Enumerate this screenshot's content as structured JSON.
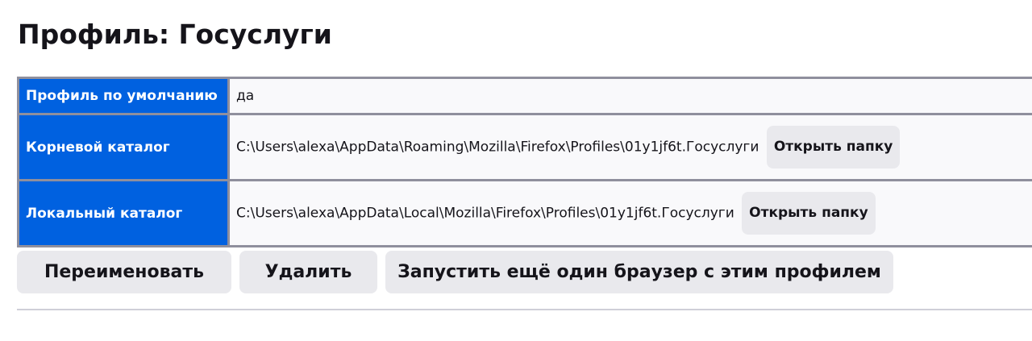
{
  "page": {
    "title": "Профиль: Госуслуги"
  },
  "profile_table": {
    "default": {
      "label": "Профиль по умолчанию",
      "value": "да"
    },
    "root_dir": {
      "label": "Корневой каталог",
      "value": "C:\\Users\\alexa\\AppData\\Roaming\\Mozilla\\Firefox\\Profiles\\01y1jf6t.Госуслуги",
      "button_label": "Открыть папку"
    },
    "local_dir": {
      "label": "Локальный каталог",
      "value": "C:\\Users\\alexa\\AppData\\Local\\Mozilla\\Firefox\\Profiles\\01y1jf6t.Госуслуги",
      "button_label": "Открыть папку"
    }
  },
  "actions": {
    "rename_label": "Переименовать",
    "delete_label": "Удалить",
    "launch_label": "Запустить ещё один браузер с этим профилем"
  },
  "colors": {
    "header_cell": "#0061e0",
    "button_bg": "#e9e9ed",
    "border": "#8f8f9d"
  }
}
